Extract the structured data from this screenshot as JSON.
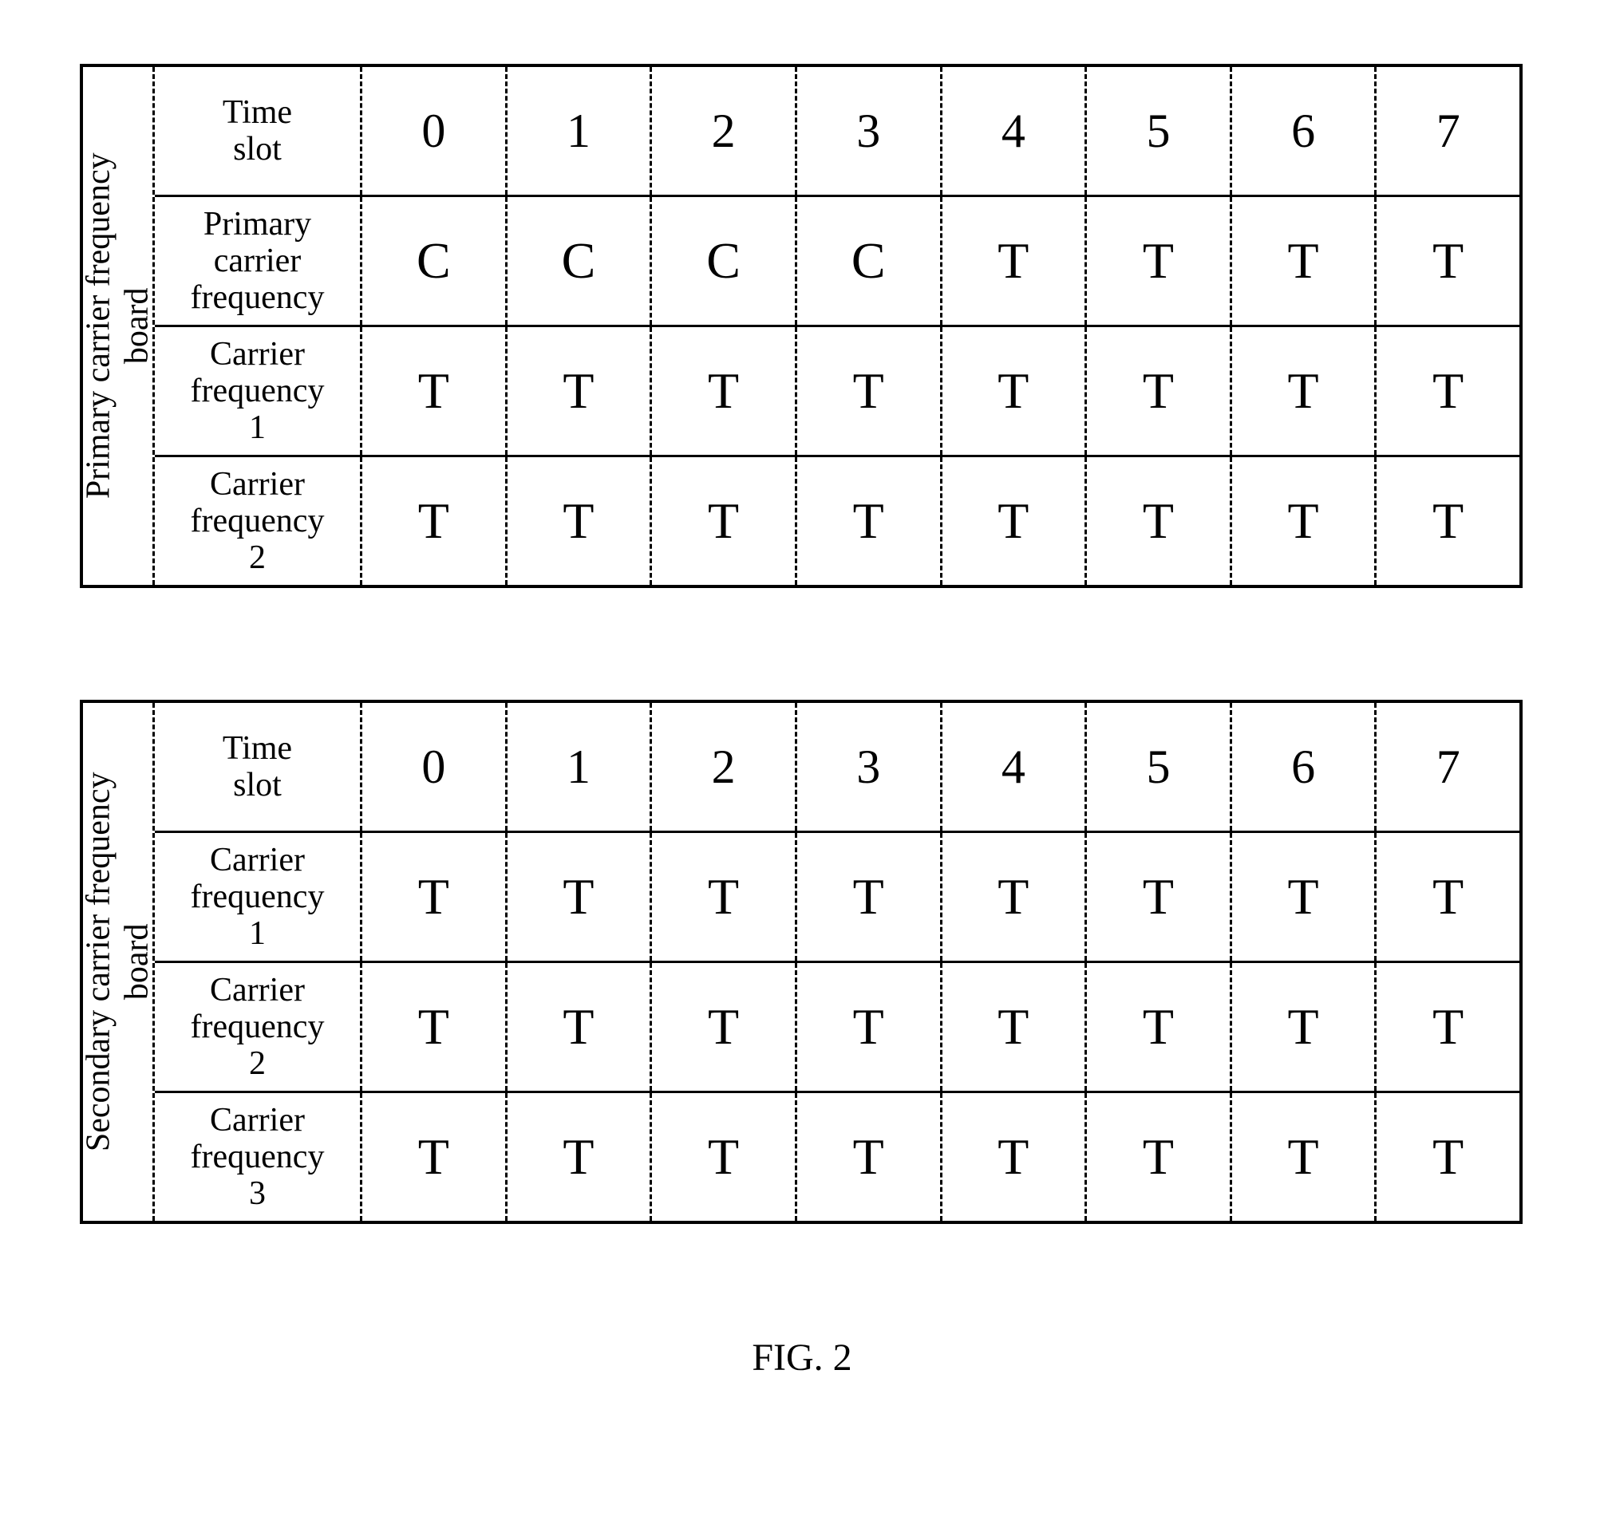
{
  "chart_data": [
    {
      "type": "table",
      "title": "Primary carrier frequency board",
      "columns": [
        "Time slot",
        "0",
        "1",
        "2",
        "3",
        "4",
        "5",
        "6",
        "7"
      ],
      "rows": [
        {
          "label": "Primary carrier frequency",
          "values": [
            "C",
            "C",
            "C",
            "C",
            "T",
            "T",
            "T",
            "T"
          ]
        },
        {
          "label": "Carrier frequency 1",
          "values": [
            "T",
            "T",
            "T",
            "T",
            "T",
            "T",
            "T",
            "T"
          ]
        },
        {
          "label": "Carrier frequency 2",
          "values": [
            "T",
            "T",
            "T",
            "T",
            "T",
            "T",
            "T",
            "T"
          ]
        }
      ]
    },
    {
      "type": "table",
      "title": "Secondary carrier frequency board",
      "columns": [
        "Time slot",
        "0",
        "1",
        "2",
        "3",
        "4",
        "5",
        "6",
        "7"
      ],
      "rows": [
        {
          "label": "Carrier frequency 1",
          "values": [
            "T",
            "T",
            "T",
            "T",
            "T",
            "T",
            "T",
            "T"
          ]
        },
        {
          "label": "Carrier frequency 2",
          "values": [
            "T",
            "T",
            "T",
            "T",
            "T",
            "T",
            "T",
            "T"
          ]
        },
        {
          "label": "Carrier frequency 3",
          "values": [
            "T",
            "T",
            "T",
            "T",
            "T",
            "T",
            "T",
            "T"
          ]
        }
      ]
    }
  ],
  "caption": "FIG. 2",
  "side_labels": {
    "primary_line1": "Primary carrier frequency",
    "primary_line2": "board",
    "secondary_line1": "Secondary carrier frequency",
    "secondary_line2": "board"
  },
  "row_labels": {
    "time_slot_line1": "Time",
    "time_slot_line2": "slot",
    "pcf_line1": "Primary",
    "pcf_line2": "carrier",
    "pcf_line3": "frequency",
    "cf_line1": "Carrier",
    "cf_line2": "frequency",
    "cf_num1": "1",
    "cf_num2": "2",
    "cf_num3": "3"
  }
}
